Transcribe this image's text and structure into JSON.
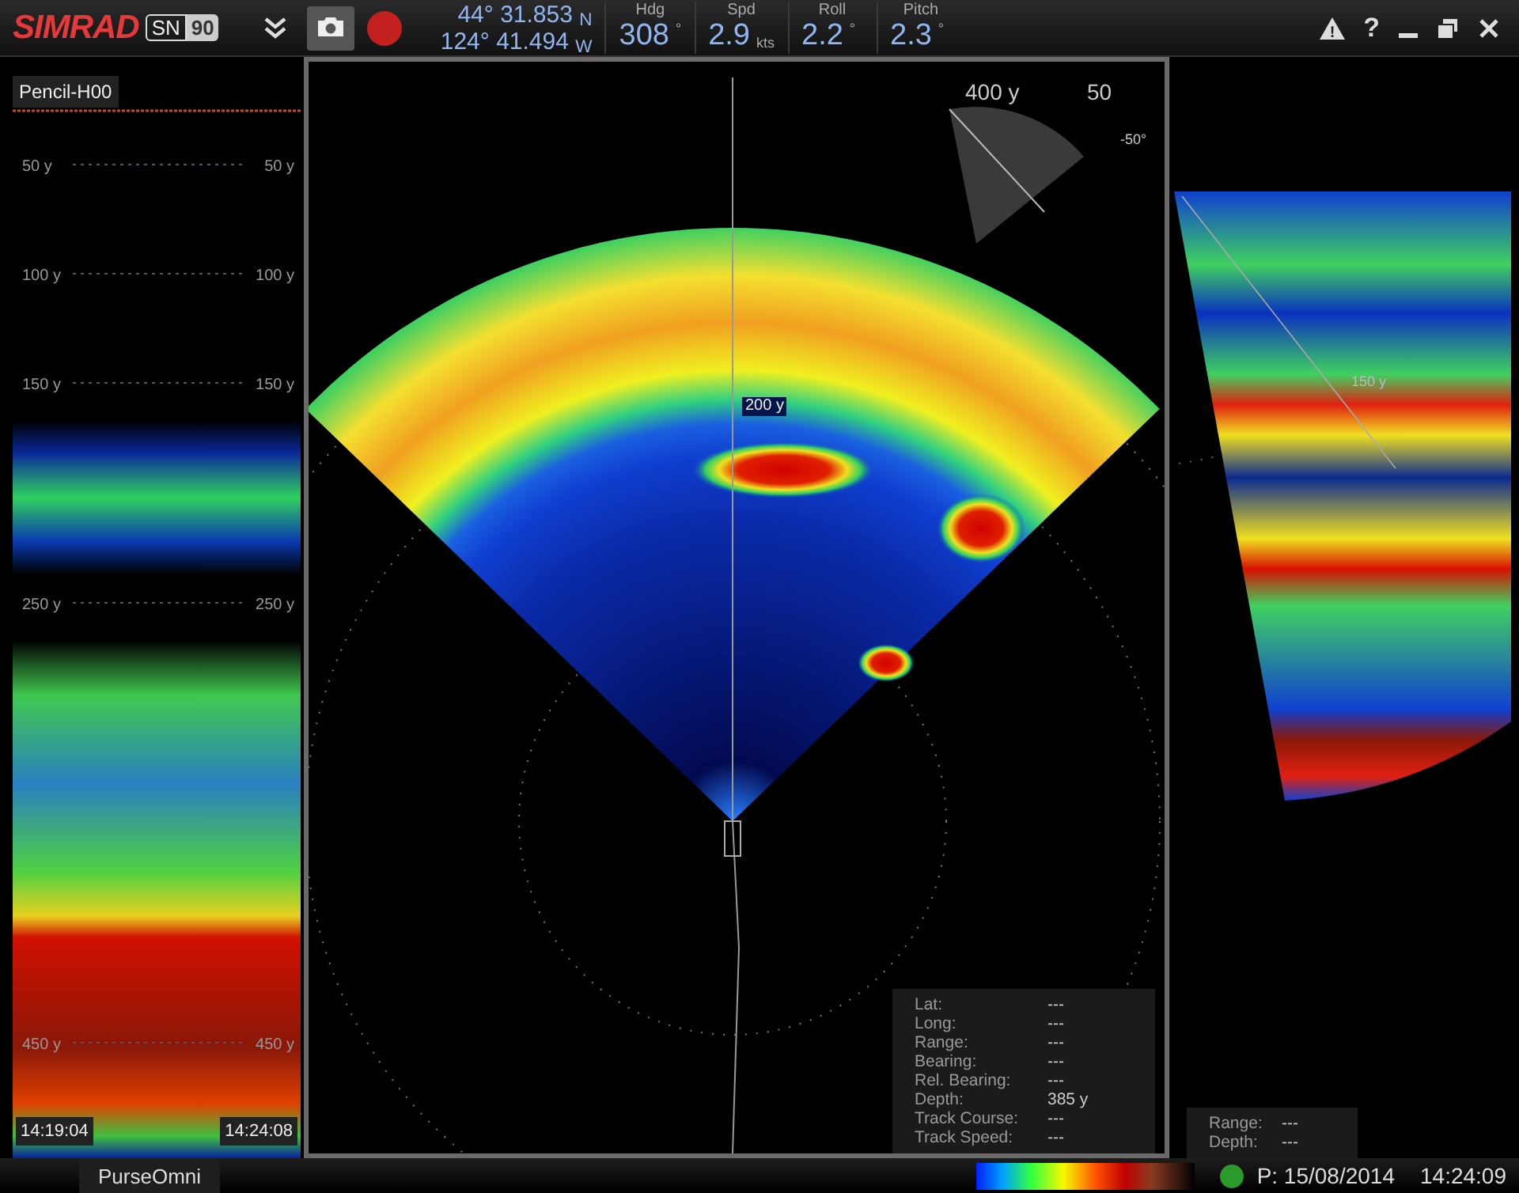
{
  "header": {
    "brand": "SIMRAD",
    "model_prefix": "SN",
    "model_number": "90",
    "lat": "44° 31.853",
    "lat_hemi": "N",
    "lon": "124° 41.494",
    "lon_hemi": "W",
    "readouts": [
      {
        "label": "Hdg",
        "value": "308",
        "unit": "°"
      },
      {
        "label": "Spd",
        "value": "2.9",
        "unit": "kts"
      },
      {
        "label": "Roll",
        "value": "2.2",
        "unit": "°"
      },
      {
        "label": "Pitch",
        "value": "2.3",
        "unit": "°"
      }
    ],
    "window_controls": [
      "!",
      "?"
    ]
  },
  "echogram": {
    "title": "Pencil-H00",
    "depth_labels": [
      {
        "left": "50 y",
        "right": "50 y"
      },
      {
        "left": "100 y",
        "right": "100 y"
      },
      {
        "left": "150 y",
        "right": "150 y"
      },
      {
        "left": "250 y",
        "right": "250 y"
      },
      {
        "left": "450 y",
        "right": "450 y"
      }
    ],
    "time_start": "14:19:04",
    "time_end": "14:24:08"
  },
  "sector": {
    "range_label": "200 y",
    "inset": {
      "range": "400 y",
      "value": "50",
      "angle": "-50°"
    },
    "readout": [
      {
        "label": "Lat:",
        "value": "---"
      },
      {
        "label": "Long:",
        "value": "---"
      },
      {
        "label": "Range:",
        "value": "---"
      },
      {
        "label": "Bearing:",
        "value": "---"
      },
      {
        "label": "Rel. Bearing:",
        "value": "---"
      },
      {
        "label": "Depth:",
        "value": "385 y"
      },
      {
        "label": "Track Course:",
        "value": "---"
      },
      {
        "label": "Track Speed:",
        "value": "---"
      }
    ]
  },
  "side_view": {
    "range_label": "150 y",
    "readout": [
      {
        "label": "Range:",
        "value": "---"
      },
      {
        "label": "Depth:",
        "value": "---"
      }
    ]
  },
  "status_bar": {
    "tab": "PurseOmni",
    "indicator": {
      "color": "#2a9a2a"
    },
    "date": "P: 15/08/2014",
    "time": "14:24:09"
  }
}
